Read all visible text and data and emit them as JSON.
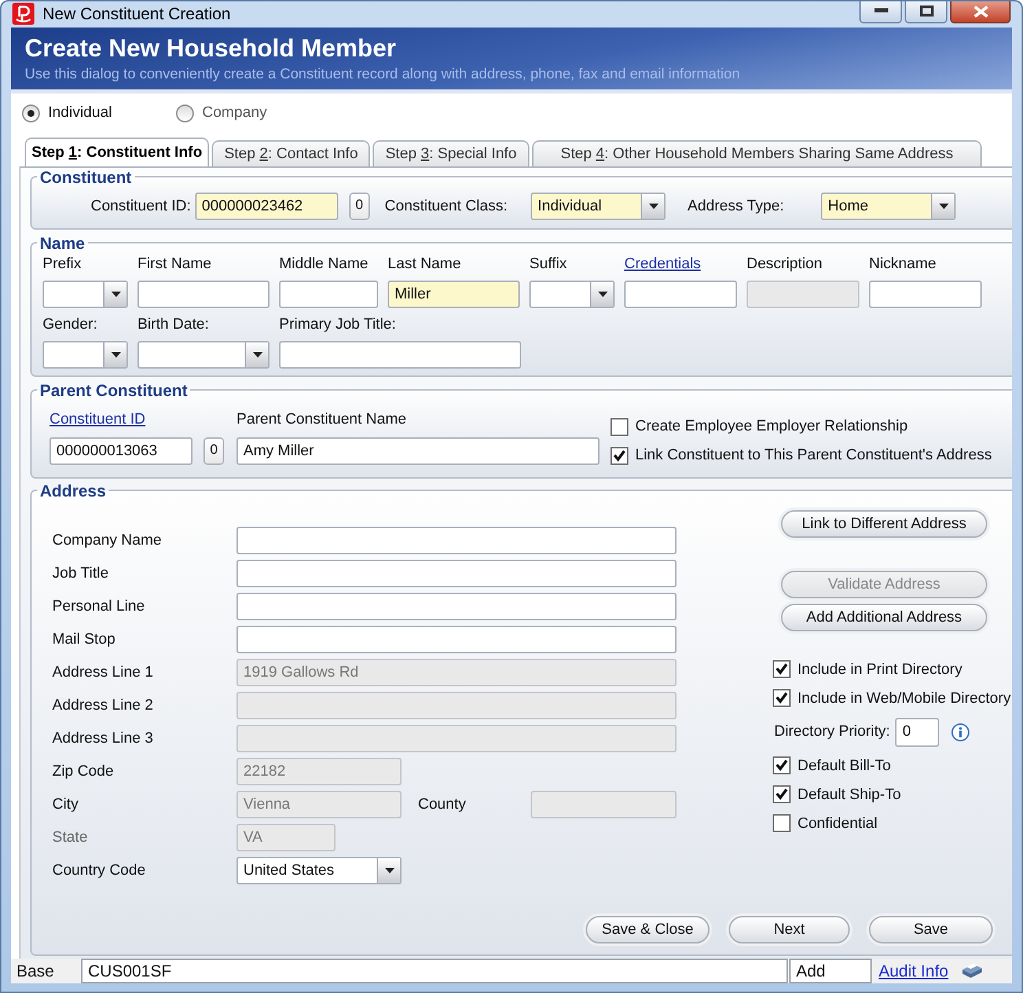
{
  "window": {
    "title": "New Constituent Creation"
  },
  "header": {
    "title": "Create New Household Member",
    "subtitle": "Use this dialog to conveniently create a Constituent record along with address, phone, fax and email information"
  },
  "record_types": [
    {
      "label": "Individual",
      "selected": true
    },
    {
      "label": "Company",
      "selected": false
    }
  ],
  "tabs": [
    {
      "prefix": "Step ",
      "key": "1",
      "suffix": ": Constituent Info",
      "selected": true
    },
    {
      "prefix": "Step ",
      "key": "2",
      "suffix": ": Contact Info",
      "selected": false
    },
    {
      "prefix": "Step ",
      "key": "3",
      "suffix": ": Special Info",
      "selected": false
    },
    {
      "prefix": "Step ",
      "key": "4",
      "suffix": ": Other Household Members Sharing Same Address",
      "selected": false
    }
  ],
  "constituent": {
    "legend": "Constituent",
    "id_label": "Constituent ID:",
    "id_value": "000000023462",
    "id_counter": "0",
    "class_label": "Constituent Class:",
    "class_value": "Individual",
    "address_type_label": "Address Type:",
    "address_type_value": "Home"
  },
  "name": {
    "legend": "Name",
    "rows": [
      [
        {
          "label": "Prefix",
          "kind": "select",
          "link": false,
          "required": false,
          "disabled": false
        },
        {
          "label": "First Name",
          "kind": "text",
          "link": false,
          "required": false,
          "disabled": false
        },
        {
          "label": "Middle Name",
          "kind": "text",
          "link": false,
          "required": false,
          "disabled": false
        },
        {
          "label": "Last Name",
          "kind": "text",
          "link": false,
          "required": true,
          "disabled": false,
          "value": "Miller"
        },
        {
          "label": "Suffix",
          "kind": "select",
          "link": false,
          "required": false,
          "disabled": false
        },
        {
          "label": "Credentials",
          "kind": "text",
          "link": true,
          "required": false,
          "disabled": false
        },
        {
          "label": "Description",
          "kind": "text",
          "link": false,
          "required": false,
          "disabled": true
        },
        {
          "label": "Nickname",
          "kind": "text",
          "link": false,
          "required": false,
          "disabled": false
        }
      ],
      [
        {
          "label": "Gender:",
          "kind": "select",
          "link": false,
          "required": false,
          "disabled": false
        },
        {
          "label": "Birth Date:",
          "kind": "select",
          "link": false,
          "required": false,
          "disabled": false
        },
        {
          "label": "Primary Job Title:",
          "kind": "text",
          "link": false,
          "required": false,
          "disabled": false
        }
      ]
    ]
  },
  "parent": {
    "legend": "Parent Constituent",
    "id_label": "Constituent ID",
    "id_value": "000000013063",
    "id_counter": "0",
    "name_label": "Parent Constituent Name",
    "name_value": "Amy Miller",
    "options": [
      {
        "label": "Create Employee Employer Relationship",
        "checked": false
      },
      {
        "label": "Link Constituent to This Parent Constituent's Address",
        "checked": true
      }
    ]
  },
  "address": {
    "legend": "Address",
    "fields": [
      {
        "label": "Company Name",
        "kind": "text",
        "disabled": false,
        "dimmed": false
      },
      {
        "label": "Job Title",
        "kind": "text",
        "disabled": false,
        "dimmed": false
      },
      {
        "label": "Personal Line",
        "kind": "text",
        "disabled": false,
        "dimmed": false
      },
      {
        "label": "Mail Stop",
        "kind": "text",
        "disabled": false,
        "dimmed": false
      },
      {
        "label": "Address Line 1",
        "kind": "text",
        "disabled": true,
        "dimmed": false,
        "value": "1919 Gallows Rd"
      },
      {
        "label": "Address Line 2",
        "kind": "text",
        "disabled": true,
        "dimmed": false
      },
      {
        "label": "Address Line 3",
        "kind": "text",
        "disabled": true,
        "dimmed": false
      },
      {
        "label": "Zip Code",
        "kind": "text",
        "disabled": true,
        "dimmed": false,
        "value": "22182"
      },
      {
        "label": "City",
        "kind": "text",
        "disabled": true,
        "dimmed": false,
        "value": "Vienna",
        "side": {
          "label": "County",
          "disabled": true
        }
      },
      {
        "label": "State",
        "kind": "text",
        "disabled": true,
        "dimmed": true,
        "value": "VA"
      },
      {
        "label": "Country Code",
        "kind": "select",
        "disabled": false,
        "dimmed": false,
        "value": "United States"
      }
    ],
    "actions": [
      {
        "label": "Link to Different Address",
        "disabled": false
      },
      {
        "label": "Validate Address",
        "disabled": true
      },
      {
        "label": "Add Additional Address",
        "disabled": false
      }
    ],
    "directory_options": [
      {
        "label": "Include in Print Directory",
        "checked": true
      },
      {
        "label": "Include in Web/Mobile Directory",
        "checked": true
      }
    ],
    "priority_label": "Directory Priority:",
    "priority_value": "0",
    "defaults": [
      {
        "label": "Default Bill-To",
        "checked": true
      },
      {
        "label": "Default Ship-To",
        "checked": true
      },
      {
        "label": "Confidential",
        "checked": false
      }
    ]
  },
  "buttons": [
    "Save & Close",
    "Next",
    "Save"
  ],
  "status_bar": {
    "mode": "Base",
    "code": "CUS001SF",
    "action": "Add",
    "link": "Audit Info"
  }
}
